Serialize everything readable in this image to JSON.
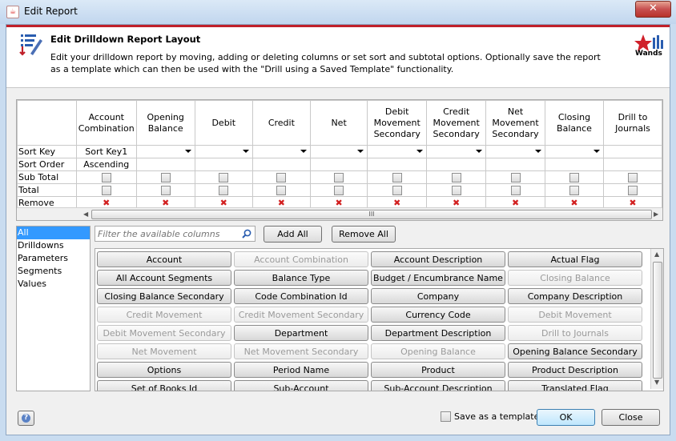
{
  "window": {
    "title": "Edit Report",
    "close_label": "✕"
  },
  "header": {
    "title": "Edit Drilldown Report Layout",
    "description": "Edit your drilldown report by moving, adding or deleting columns or set sort and subtotal options. Optionally save the report as a template which can then be used with the \"Drill using a Saved Template\" functionality.",
    "logo_text": "Wands"
  },
  "grid": {
    "columns": [
      "Account Combination",
      "Opening Balance",
      "Debit",
      "Credit",
      "Net",
      "Debit Movement Secondary",
      "Credit Movement Secondary",
      "Net Movement Secondary",
      "Closing Balance",
      "Drill to Journals"
    ],
    "row_labels": {
      "sort_key": "Sort Key",
      "sort_order": "Sort Order",
      "sub_total": "Sub Total",
      "total": "Total",
      "remove": "Remove"
    },
    "first_col": {
      "sort_key": "Sort Key1",
      "sort_order": "Ascending"
    },
    "remove_glyph": "✖",
    "scroll_grip": "III"
  },
  "categories": [
    "All",
    "Drilldowns",
    "Parameters",
    "Segments",
    "Values"
  ],
  "filter": {
    "placeholder": "Filter the available columns"
  },
  "actions": {
    "add_all": "Add All",
    "remove_all": "Remove All"
  },
  "available_columns": [
    {
      "label": "Account",
      "enabled": true
    },
    {
      "label": "Account Combination",
      "enabled": false
    },
    {
      "label": "Account Description",
      "enabled": true
    },
    {
      "label": "Actual Flag",
      "enabled": true
    },
    {
      "label": "All Account Segments",
      "enabled": true
    },
    {
      "label": "Balance Type",
      "enabled": true
    },
    {
      "label": "Budget / Encumbrance Name",
      "enabled": true
    },
    {
      "label": "Closing Balance",
      "enabled": false
    },
    {
      "label": "Closing Balance Secondary",
      "enabled": true
    },
    {
      "label": "Code Combination Id",
      "enabled": true
    },
    {
      "label": "Company",
      "enabled": true
    },
    {
      "label": "Company Description",
      "enabled": true
    },
    {
      "label": "Credit Movement",
      "enabled": false
    },
    {
      "label": "Credit Movement Secondary",
      "enabled": false
    },
    {
      "label": "Currency Code",
      "enabled": true
    },
    {
      "label": "Debit Movement",
      "enabled": false
    },
    {
      "label": "Debit Movement Secondary",
      "enabled": false
    },
    {
      "label": "Department",
      "enabled": true
    },
    {
      "label": "Department Description",
      "enabled": true
    },
    {
      "label": "Drill to Journals",
      "enabled": false
    },
    {
      "label": "Net Movement",
      "enabled": false
    },
    {
      "label": "Net Movement Secondary",
      "enabled": false
    },
    {
      "label": "Opening Balance",
      "enabled": false
    },
    {
      "label": "Opening Balance Secondary",
      "enabled": true
    },
    {
      "label": "Options",
      "enabled": true
    },
    {
      "label": "Period Name",
      "enabled": true
    },
    {
      "label": "Product",
      "enabled": true
    },
    {
      "label": "Product Description",
      "enabled": true
    },
    {
      "label": "Set of Books Id",
      "enabled": true
    },
    {
      "label": "Sub-Account",
      "enabled": true
    },
    {
      "label": "Sub-Account Description",
      "enabled": true
    },
    {
      "label": "Translated Flag",
      "enabled": true
    }
  ],
  "footer": {
    "help_glyph": "?",
    "save_template_label": "Save as a template",
    "ok_label": "OK",
    "close_label": "Close"
  },
  "colors": {
    "accent_red": "#c0202a",
    "selection_blue": "#3399ff",
    "remove_red": "#d21f1f"
  }
}
